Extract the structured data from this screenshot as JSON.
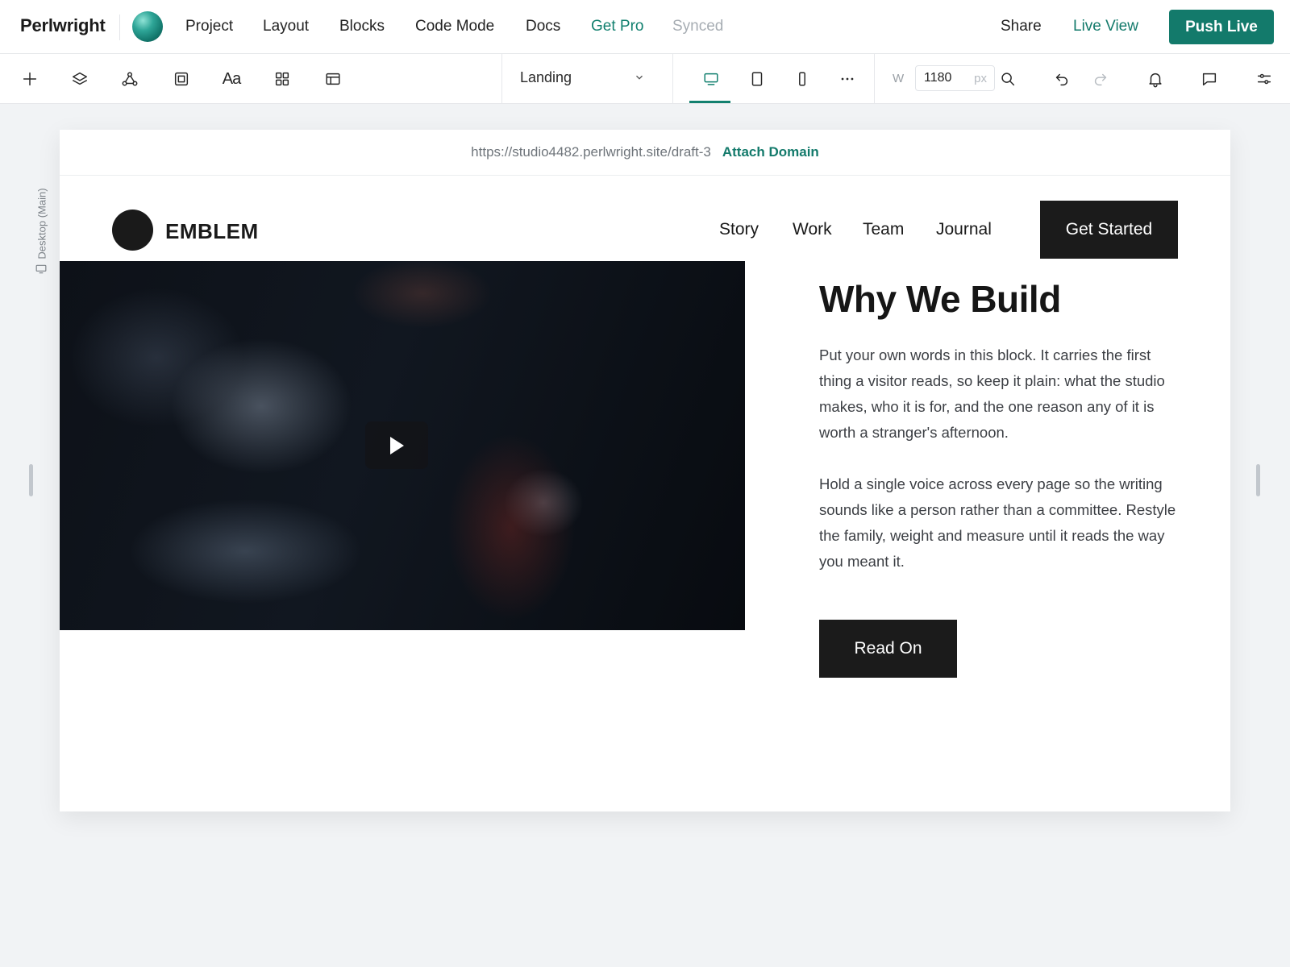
{
  "app": {
    "name": "Perlwright",
    "menu": [
      "Project",
      "Layout",
      "Blocks",
      "Code Mode",
      "Docs"
    ],
    "get_pro": "Get Pro",
    "sync_status": "Synced",
    "share": "Share",
    "live_view": "Live View",
    "push_live": "Push Live",
    "accent_color": "#137a6b"
  },
  "toolbar": {
    "tools": [
      "plus-icon",
      "layers-icon",
      "components-icon",
      "frame-icon",
      "typography-icon",
      "grid-icon",
      "layout-icon"
    ],
    "typography_glyph": "Aa",
    "page_select": "Landing",
    "devices": [
      "desktop-icon",
      "tablet-icon",
      "mobile-icon",
      "more-icon"
    ],
    "width_label": "W",
    "width_value": "1180",
    "width_unit": "px"
  },
  "canvas": {
    "breakpoint_label": "Desktop (Main)",
    "url": "https://studio4482.perlwright.site/draft-3",
    "attach_domain": "Attach Domain"
  },
  "site": {
    "brand": "EMBLEM",
    "nav": [
      "Story",
      "Work",
      "Team",
      "Journal"
    ],
    "cta": "Get Started",
    "heading": "Why We Build",
    "paragraph1": "Put your own words in this block. It carries the first thing a visitor reads, so keep it plain: what the studio makes, who it is for, and the one reason any of it is worth a stranger's afternoon.",
    "paragraph2": "Hold a single voice across every page so the writing sounds like a person rather than a committee. Restyle the family, weight and measure until it reads the way you meant it.",
    "read_on": "Read On"
  }
}
